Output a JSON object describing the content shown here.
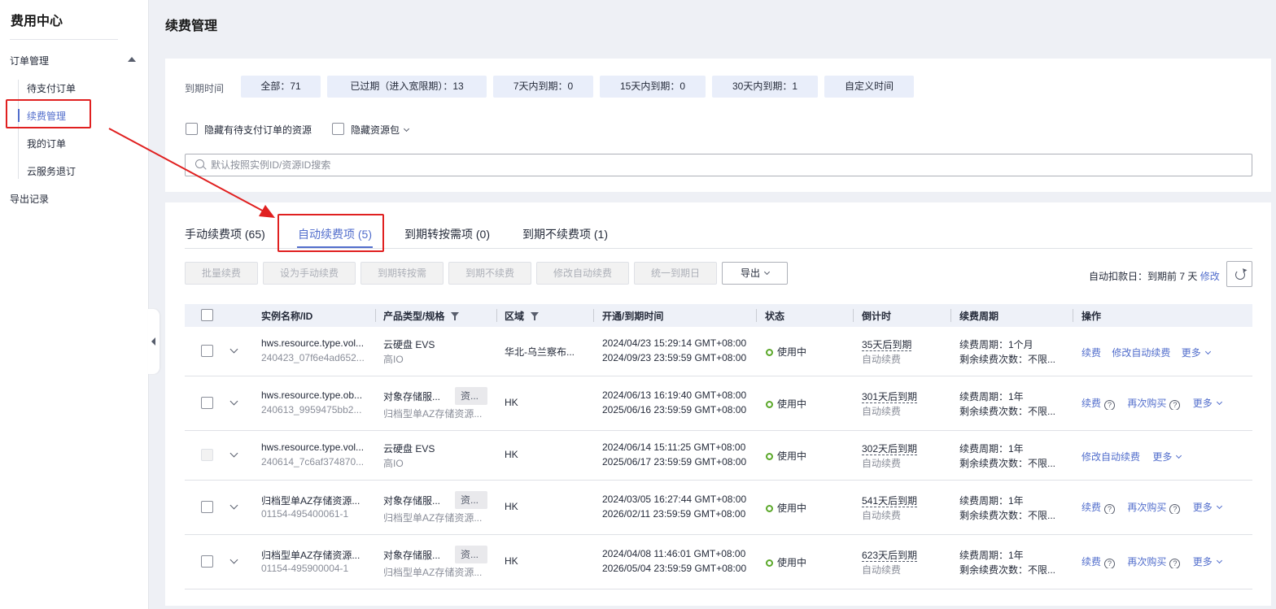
{
  "sidebar": {
    "title": "费用中心",
    "group": "订单管理",
    "items": [
      "待支付订单",
      "续费管理",
      "我的订单",
      "云服务退订"
    ],
    "export": "导出记录"
  },
  "page": {
    "title": "续费管理"
  },
  "filter": {
    "due_label": "到期时间",
    "buttons": [
      "全部：71",
      "已过期（进入宽限期）：13",
      "7天内到期：0",
      "15天内到期：0",
      "30天内到期：1",
      "自定义时间"
    ],
    "hide_pending": "隐藏有待支付订单的资源",
    "hide_package": "隐藏资源包",
    "search_placeholder": "默认按照实例ID/资源ID搜索"
  },
  "tabs": [
    "手动续费项 (65)",
    "自动续费项 (5)",
    "到期转按需项 (0)",
    "到期不续费项 (1)"
  ],
  "actions": {
    "batch_renew": "批量续费",
    "set_manual": "设为手动续费",
    "to_on_demand": "到期转按需",
    "no_renew": "到期不续费",
    "modify_auto": "修改自动续费",
    "unify_date": "统一到期日",
    "export": "导出",
    "auto_deduct": "自动扣款日：到期前 7 天",
    "modify": "修改"
  },
  "columns": [
    "实例名称/ID",
    "产品类型/规格",
    "区域",
    "开通/到期时间",
    "状态",
    "倒计时",
    "续费周期",
    "操作"
  ],
  "rows": [
    {
      "name": "hws.resource.type.vol...",
      "id": "240423_07f6e4ad652...",
      "product": "云硬盘 EVS",
      "spec": "高IO",
      "tag": "",
      "region": "华北-乌兰察布...",
      "open": "2024/04/23 15:29:14 GMT+08:00",
      "expire": "2024/09/23 23:59:59 GMT+08:00",
      "status": "使用中",
      "countdown": "35天后到期",
      "renew_type": "自动续费",
      "period": "续费周期：1个月",
      "remaining": "剩余续费次数：不限...",
      "ops": [
        "续费",
        "修改自动续费",
        "更多"
      ],
      "qmarks": false
    },
    {
      "name": "hws.resource.type.ob...",
      "id": "240613_9959475bb2...",
      "product": "对象存储服...",
      "spec": "归档型单AZ存储资源...",
      "tag": "资...",
      "region": "HK",
      "open": "2024/06/13 16:19:40 GMT+08:00",
      "expire": "2025/06/16 23:59:59 GMT+08:00",
      "status": "使用中",
      "countdown": "301天后到期",
      "renew_type": "自动续费",
      "period": "续费周期：1年",
      "remaining": "剩余续费次数：不限...",
      "ops": [
        "续费",
        "再次购买",
        "更多"
      ],
      "qmarks": true
    },
    {
      "name": "hws.resource.type.vol...",
      "id": "240614_7c6af374870...",
      "product": "云硬盘 EVS",
      "spec": "高IO",
      "tag": "",
      "region": "HK",
      "open": "2024/06/14 15:11:25 GMT+08:00",
      "expire": "2025/06/17 23:59:59 GMT+08:00",
      "status": "使用中",
      "countdown": "302天后到期",
      "renew_type": "自动续费",
      "period": "续费周期：1年",
      "remaining": "剩余续费次数：不限...",
      "ops": [
        "修改自动续费",
        "更多"
      ],
      "qmarks": false
    },
    {
      "name": "归档型单AZ存储资源...",
      "id": "01154-495400061-1",
      "product": "对象存储服...",
      "spec": "归档型单AZ存储资源...",
      "tag": "资...",
      "region": "HK",
      "open": "2024/03/05 16:27:44 GMT+08:00",
      "expire": "2026/02/11 23:59:59 GMT+08:00",
      "status": "使用中",
      "countdown": "541天后到期",
      "renew_type": "自动续费",
      "period": "续费周期：1年",
      "remaining": "剩余续费次数：不限...",
      "ops": [
        "续费",
        "再次购买",
        "更多"
      ],
      "qmarks": true
    },
    {
      "name": "归档型单AZ存储资源...",
      "id": "01154-495900004-1",
      "product": "对象存储服...",
      "spec": "归档型单AZ存储资源...",
      "tag": "资...",
      "region": "HK",
      "open": "2024/04/08 11:46:01 GMT+08:00",
      "expire": "2026/05/04 23:59:59 GMT+08:00",
      "status": "使用中",
      "countdown": "623天后到期",
      "renew_type": "自动续费",
      "period": "续费周期：1年",
      "remaining": "剩余续费次数：不限...",
      "ops": [
        "续费",
        "再次购买",
        "更多"
      ],
      "qmarks": true
    }
  ],
  "colors": {
    "accent": "#526ecc",
    "annotation": "#e02020",
    "status_ok": "#5ba82a"
  }
}
